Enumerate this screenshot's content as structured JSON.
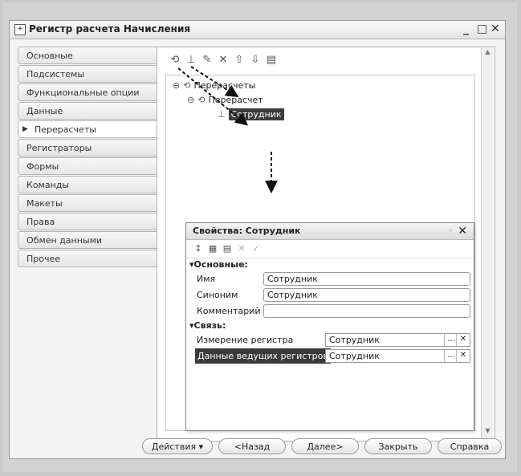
{
  "window": {
    "title": "Регистр расчета Начисления",
    "title_icon": "register-icon",
    "minimize": "_",
    "maximize": "□",
    "close": "✕"
  },
  "tabs": [
    {
      "label": "Основные",
      "active": false
    },
    {
      "label": "Подсистемы",
      "active": false
    },
    {
      "label": "Функциональные опции",
      "active": false
    },
    {
      "label": "Данные",
      "active": false
    },
    {
      "label": "Перерасчеты",
      "active": true
    },
    {
      "label": "Регистраторы",
      "active": false
    },
    {
      "label": "Формы",
      "active": false
    },
    {
      "label": "Команды",
      "active": false
    },
    {
      "label": "Макеты",
      "active": false
    },
    {
      "label": "Права",
      "active": false
    },
    {
      "label": "Обмен данными",
      "active": false
    },
    {
      "label": "Прочее",
      "active": false
    }
  ],
  "toolbar_icons": [
    "add-icon",
    "add-subitem-icon",
    "edit-icon",
    "delete-icon",
    "move-up-icon",
    "move-down-icon",
    "properties-icon"
  ],
  "tree": {
    "root": "Перерасчеты",
    "child": "Перерасчет",
    "leaf": "Сотрудник"
  },
  "properties": {
    "title": "Свойства: Сотрудник",
    "section_main": "Основные:",
    "name_label": "Имя",
    "name_value": "Сотрудник",
    "synonym_label": "Синоним",
    "synonym_value": "Сотрудник",
    "comment_label": "Комментарий",
    "comment_value": "",
    "section_link": "Связь:",
    "dimension_label": "Измерение регистра",
    "dimension_value": "Сотрудник",
    "leading_label": "Данные ведущих регистров",
    "leading_value": "Сотрудник",
    "ellipsis": "...",
    "clear": "✕"
  },
  "buttons": {
    "actions": "Действия",
    "back": "<Назад",
    "next": "Далее>",
    "close": "Закрыть",
    "help": "Справка"
  },
  "colors": {
    "selection": "#3c3c3c",
    "arrow": "#111111"
  }
}
